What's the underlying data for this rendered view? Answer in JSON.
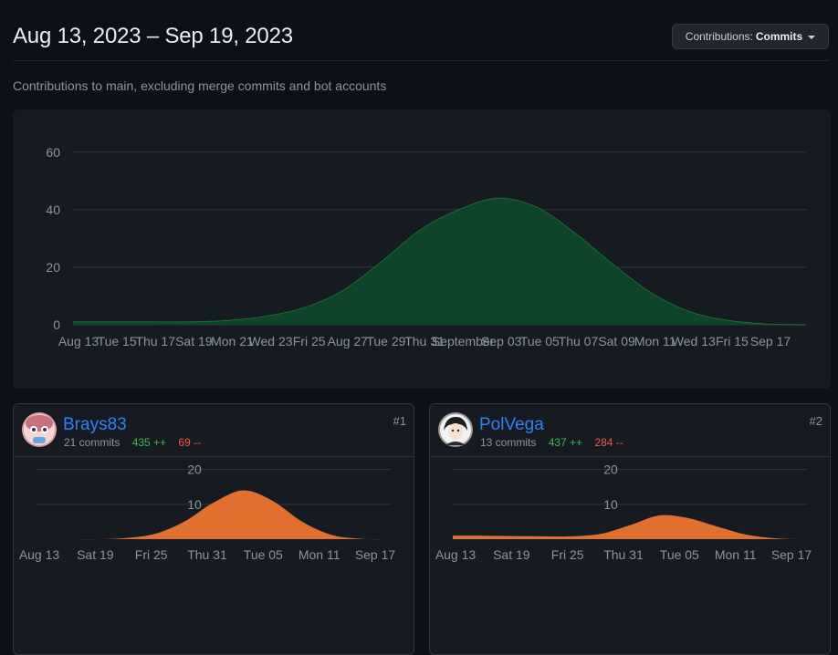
{
  "header": {
    "title": "Aug 13, 2023 – Sep 19, 2023",
    "filter_label": "Contributions:",
    "filter_value": "Commits"
  },
  "subtitle": "Contributions to main, excluding merge commits and bot accounts",
  "colors": {
    "total_area": "#0e4429",
    "total_line": "#26a641",
    "contributor_area": "#e16f2f"
  },
  "contributors": [
    {
      "rank": "#1",
      "name": "Brays83",
      "commits": "21 commits",
      "additions": "435 ++",
      "deletions": "69 --",
      "avatar": "avatar-icon"
    },
    {
      "rank": "#2",
      "name": "PolVega",
      "commits": "13 commits",
      "additions": "437 ++",
      "deletions": "284 --",
      "avatar": "avatar-icon"
    }
  ],
  "chart_data": [
    {
      "type": "area",
      "title": "",
      "xlabel": "",
      "ylabel": "",
      "ylim": [
        0,
        65
      ],
      "yticks": [
        0,
        20,
        40,
        60
      ],
      "grid": true,
      "x_tick_labels": [
        "Aug 13",
        "Tue 15",
        "Thu 17",
        "Sat 19",
        "Mon 21",
        "Wed 23",
        "Fri 25",
        "Aug 27",
        "Tue 29",
        "Thu 31",
        "September",
        "Sep 03",
        "Tue 05",
        "Thu 07",
        "Sat 09",
        "Mon 11",
        "Wed 13",
        "Fri 15",
        "Sep 17"
      ],
      "x": [
        "Aug 13",
        "Aug 15",
        "Aug 17",
        "Aug 19",
        "Aug 21",
        "Aug 23",
        "Aug 25",
        "Aug 27",
        "Aug 29",
        "Aug 31",
        "Sep 01",
        "Sep 03",
        "Sep 05",
        "Sep 07",
        "Sep 09",
        "Sep 11",
        "Sep 13",
        "Sep 15",
        "Sep 17",
        "Sep 19"
      ],
      "series": [
        {
          "values": [
            1,
            1,
            1,
            1,
            1.5,
            3,
            6,
            12,
            22,
            33,
            40,
            44,
            41,
            32,
            21,
            11,
            4.5,
            1.5,
            0.3,
            0
          ]
        }
      ]
    },
    {
      "type": "area",
      "title": "",
      "ylim": [
        0,
        22
      ],
      "yticks": [
        10,
        20
      ],
      "grid": true,
      "x_tick_labels": [
        "Aug 13",
        "Sat 19",
        "Fri 25",
        "Thu 31",
        "Tue 05",
        "Mon 11",
        "Sep 17"
      ],
      "x": [
        "Aug 13",
        "Aug 16",
        "Aug 19",
        "Aug 22",
        "Aug 25",
        "Aug 28",
        "Aug 31",
        "Sep 03",
        "Sep 06",
        "Sep 09",
        "Sep 12",
        "Sep 15",
        "Sep 18"
      ],
      "series": [
        {
          "values": [
            0,
            0,
            0,
            0.3,
            1.5,
            5,
            10.5,
            14,
            11,
            5,
            1.2,
            0.1,
            0
          ]
        }
      ]
    },
    {
      "type": "area",
      "title": "",
      "ylim": [
        0,
        22
      ],
      "yticks": [
        10,
        20
      ],
      "grid": true,
      "x_tick_labels": [
        "Aug 13",
        "Sat 19",
        "Fri 25",
        "Thu 31",
        "Tue 05",
        "Mon 11",
        "Sep 17"
      ],
      "x": [
        "Aug 13",
        "Aug 16",
        "Aug 19",
        "Aug 22",
        "Aug 25",
        "Aug 28",
        "Aug 31",
        "Sep 03",
        "Sep 06",
        "Sep 09",
        "Sep 12",
        "Sep 15",
        "Sep 18"
      ],
      "series": [
        {
          "values": [
            1,
            1,
            0.9,
            0.8,
            0.8,
            1.5,
            4,
            6.8,
            6,
            3.5,
            1.2,
            0.2,
            0
          ]
        }
      ]
    }
  ]
}
